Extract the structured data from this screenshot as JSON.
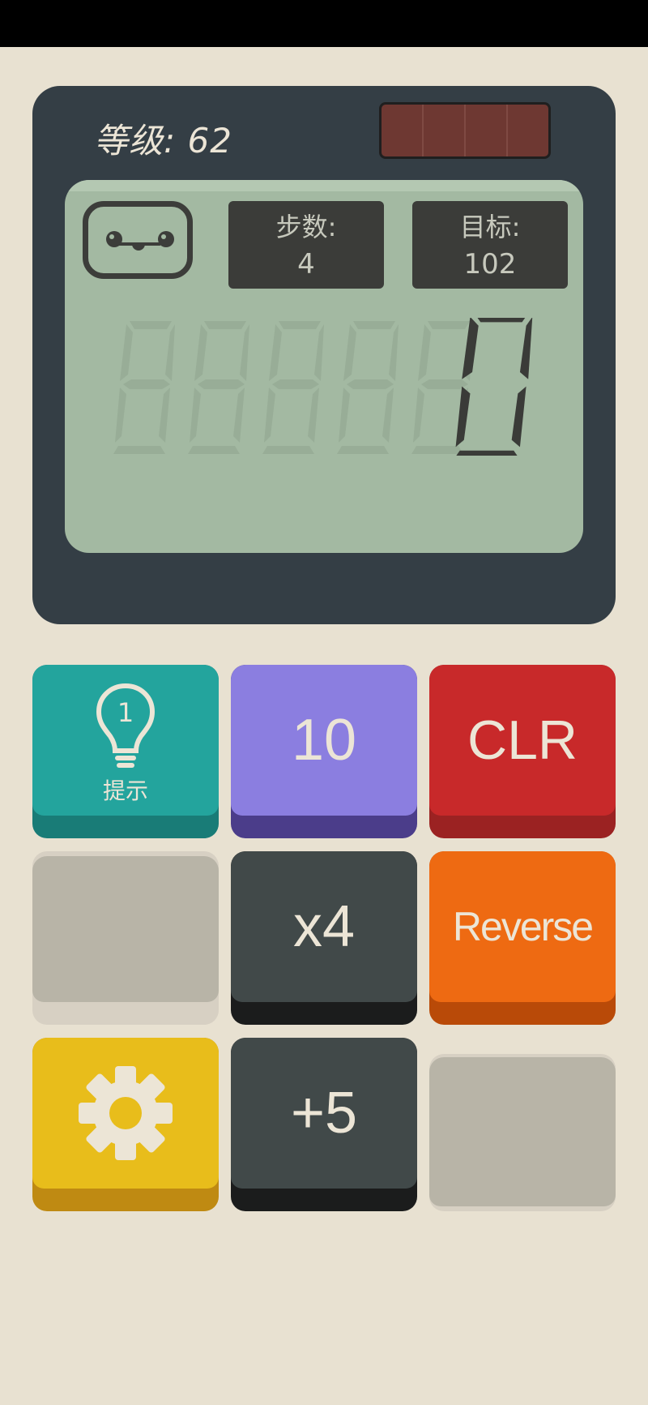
{
  "header": {
    "level_label": "等级: 62"
  },
  "screen": {
    "moves_label": "步数:",
    "moves_value": "4",
    "goal_label": "目标:",
    "goal_value": "102",
    "display_value": "0"
  },
  "buttons": {
    "hint": {
      "number": "1",
      "label": "提示"
    },
    "ten": "10",
    "clear": "CLR",
    "times_four": "x4",
    "reverse": "Reverse",
    "plus_five": "+5"
  },
  "colors": {
    "background": "#e8e1d1",
    "calculator_body": "#343e45",
    "lcd": "#a3b9a2",
    "solar_panel": "#6e3832",
    "hint_button": "#23a49d",
    "number_button": "#8b7ee0",
    "clear_button": "#c8292a",
    "operation_button": "#414949",
    "reverse_button": "#ee6a12",
    "settings_button": "#e8bd1b",
    "empty_slot": "#b8b4a7"
  },
  "icons": {
    "hint": "lightbulb-icon",
    "settings": "gear-icon",
    "face": "smiley-face-icon"
  }
}
